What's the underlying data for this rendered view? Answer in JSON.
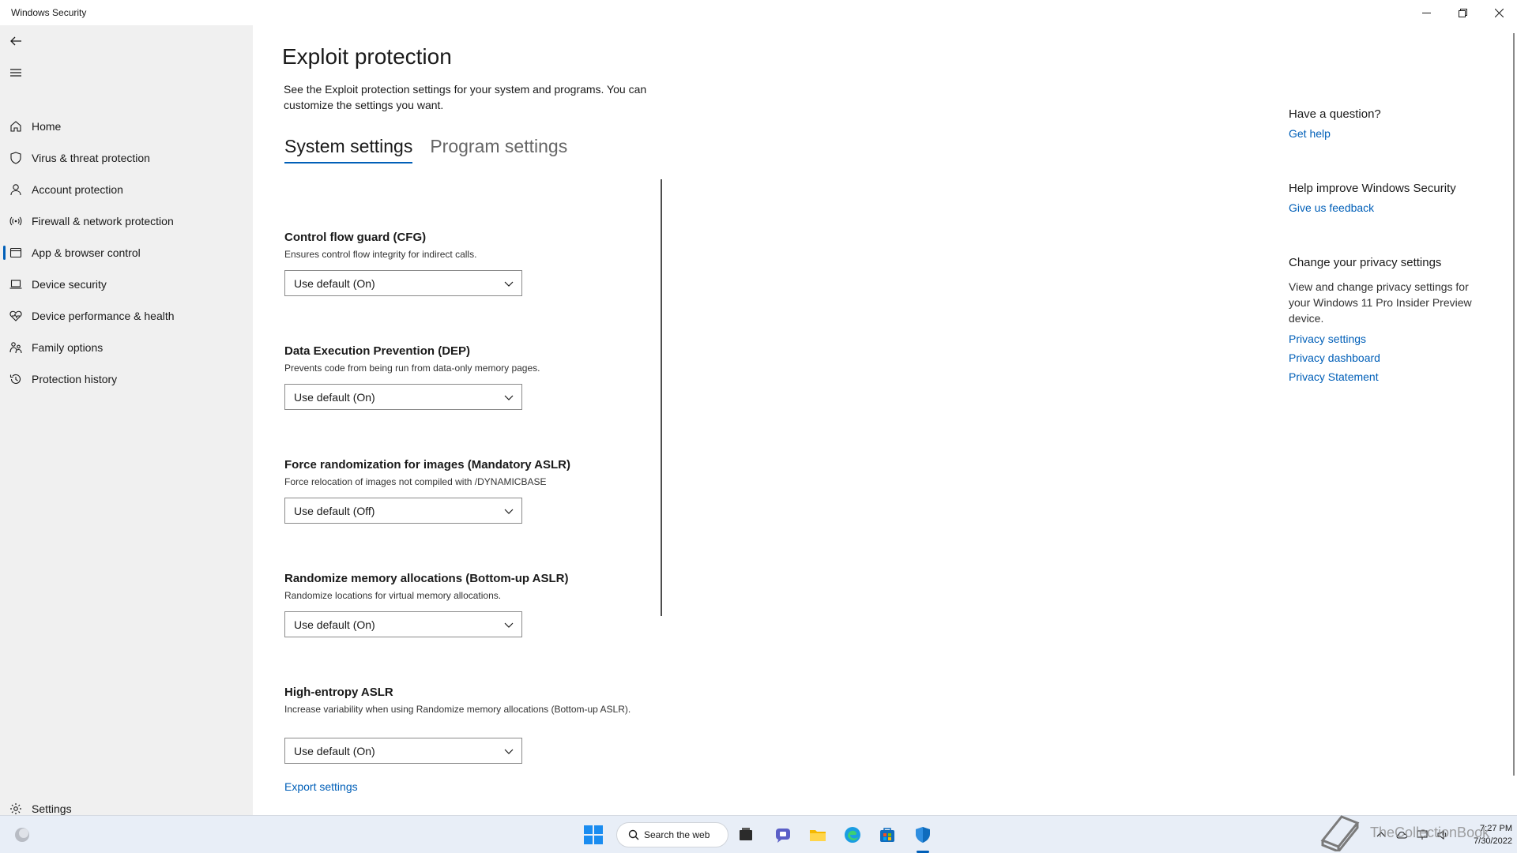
{
  "window": {
    "title": "Windows Security",
    "controls": [
      "minimize",
      "restore",
      "close"
    ]
  },
  "sidebar": {
    "back_icon": "back-arrow-icon",
    "menu_icon": "hamburger-menu-icon",
    "items": [
      {
        "label": "Home",
        "icon": "home-icon"
      },
      {
        "label": "Virus & threat protection",
        "icon": "shield-icon"
      },
      {
        "label": "Account protection",
        "icon": "person-icon"
      },
      {
        "label": "Firewall & network protection",
        "icon": "wifi-antenna-icon"
      },
      {
        "label": "App & browser control",
        "icon": "app-window-icon",
        "active": true
      },
      {
        "label": "Device security",
        "icon": "laptop-icon"
      },
      {
        "label": "Device performance & health",
        "icon": "heart-pulse-icon"
      },
      {
        "label": "Family options",
        "icon": "family-icon"
      },
      {
        "label": "Protection history",
        "icon": "history-icon"
      }
    ],
    "settings_label": "Settings"
  },
  "main": {
    "title": "Exploit protection",
    "description": "See the Exploit protection settings for your system and programs.  You can customize the settings you want.",
    "tabs": [
      {
        "label": "System settings",
        "active": true
      },
      {
        "label": "Program settings",
        "active": false
      }
    ],
    "settings": [
      {
        "title": "Control flow guard (CFG)",
        "description": "Ensures control flow integrity for indirect calls.",
        "value": "Use default (On)"
      },
      {
        "title": "Data Execution Prevention (DEP)",
        "description": "Prevents code from being run from data-only memory pages.",
        "value": "Use default (On)"
      },
      {
        "title": "Force randomization for images (Mandatory ASLR)",
        "description": "Force relocation of images not compiled with /DYNAMICBASE",
        "value": "Use default (Off)"
      },
      {
        "title": "Randomize memory allocations (Bottom-up ASLR)",
        "description": "Randomize locations for virtual memory allocations.",
        "value": "Use default (On)"
      },
      {
        "title": "High-entropy ASLR",
        "description": "Increase variability when using Randomize memory allocations (Bottom-up ASLR).",
        "value": "Use default (On)"
      }
    ],
    "export_link": "Export settings"
  },
  "right_column": {
    "question": {
      "heading": "Have a question?",
      "link": "Get help"
    },
    "improve": {
      "heading": "Help improve Windows Security",
      "link": "Give us feedback"
    },
    "privacy": {
      "heading": "Change your privacy settings",
      "text": "View and change privacy settings for your Windows 11 Pro Insider Preview device.",
      "links": [
        "Privacy settings",
        "Privacy dashboard",
        "Privacy Statement"
      ]
    }
  },
  "taskbar": {
    "search_text": "Search the web",
    "apps": [
      "start-icon",
      "task-view-icon",
      "teams-chat-icon",
      "file-explorer-icon",
      "edge-icon",
      "store-icon",
      "windows-security-icon"
    ],
    "time": "7:27 PM",
    "date": "7/30/2022",
    "watermark": "TheCollectionBook"
  },
  "colors": {
    "accent": "#005fb8",
    "sidebar_bg": "#f0f0f0",
    "taskbar_bg": "#e8eef7"
  }
}
